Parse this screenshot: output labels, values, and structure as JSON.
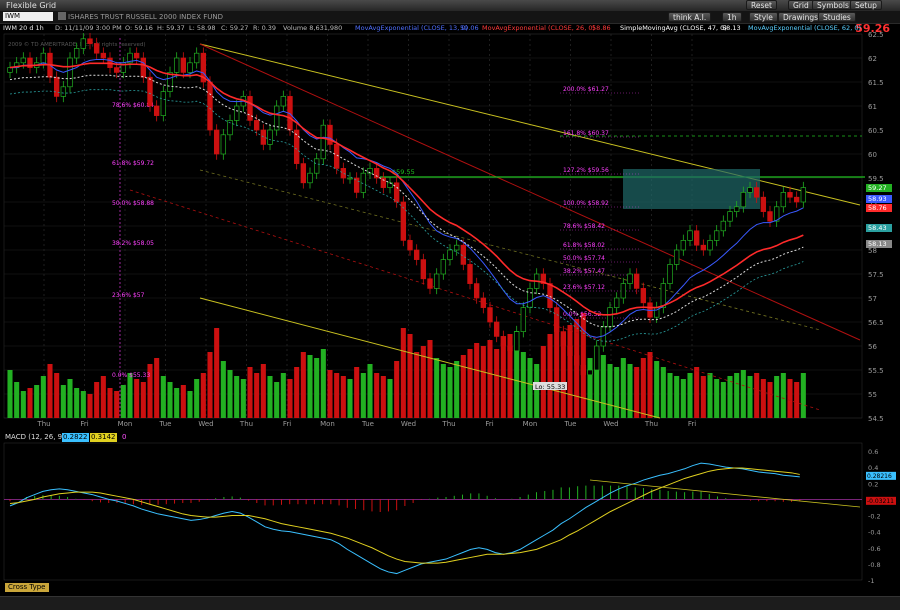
{
  "window": {
    "title": "Flexible Grid"
  },
  "header": {
    "symbol": "IWM",
    "symbol_name": "ISHARES TRUST RUSSELL 2000 INDEX FUND",
    "last_price": "59.26",
    "buttons": [
      "Reset",
      "Grid",
      "Symbols",
      "Setup"
    ],
    "tools": [
      "think A.I.",
      "1h",
      "Style",
      "Drawings",
      "Studies"
    ]
  },
  "info_line": [
    "IWM 20 d 1h",
    "D: 11/11/09 3:00 PM",
    "O: 59.16",
    "H: 59.37",
    "L: 58.98",
    "C: 59.27",
    "R: 0.39",
    "Volume 8,631,980",
    "MovAvgExponential (CLOSE, 13, 0)",
    "MovAvgExponential (CLOSE, 26, 0)",
    "SimpleMovingAvg (CLOSE, 47, 0)",
    "MovAvgExponential (CLOSE, 62, 0)"
  ],
  "info_values": [
    "59.06",
    "58.86",
    "58.13"
  ],
  "watermark": "2009 © TD AMERITRADE, Inc. (all rights reserved)",
  "macd_header": [
    "MACD (12, 26, 9)",
    "0.2822",
    "0.3142",
    "0"
  ],
  "cross_type": "Cross Type",
  "colors": {
    "up": "#22b022",
    "down": "#cc1010",
    "ema13": "#3a5aff",
    "ema26": "#ff2a2a",
    "macd": "#3ac0ff",
    "signal": "#e0d020",
    "fib": "#ff40ff",
    "box": "#1f6a6a"
  },
  "chart_data": [
    {
      "type": "candlestick",
      "title": "IWM 20 d 1h",
      "x_tick_labels": [
        "Thu",
        "Fri",
        "Mon",
        "Tue",
        "Wed",
        "Thu",
        "Fri",
        "Mon",
        "Tue",
        "Wed",
        "Thu",
        "Fri",
        "Mon",
        "Tue",
        "Wed",
        "Thu",
        "Fri"
      ],
      "y_tick_labels": [
        62.5,
        62,
        61.5,
        61,
        60.5,
        60,
        59.5,
        59,
        58.5,
        58,
        57.5,
        57,
        56.5,
        56,
        55.5,
        55,
        54.5
      ],
      "ylim": [
        54.5,
        62.5
      ],
      "right_axis_badges": [
        "59.27",
        "58.93",
        "58.76",
        "58.43",
        "58.13"
      ],
      "fib_retracement": [
        {
          "level": "200.0%",
          "price": "$61.27"
        },
        {
          "level": "161.8%",
          "price": "$60.37"
        },
        {
          "level": "127.2%",
          "price": "$59.56"
        },
        {
          "level": "100.0%",
          "price": "$58.92"
        },
        {
          "level": "78.6%",
          "price": "$58.42"
        },
        {
          "level": "61.8%",
          "price": "$58.02"
        },
        {
          "level": "50.0%",
          "price": "$57.74"
        },
        {
          "level": "38.2%",
          "price": "$57.47"
        },
        {
          "level": "23.6%",
          "price": "$57.12"
        },
        {
          "level": "0.0%",
          "price": "$56.52"
        }
      ],
      "fib_left": [
        {
          "level": "78.6%",
          "price": "$60.84"
        },
        {
          "level": "61.8%",
          "price": "$59.72"
        },
        {
          "level": "50.0%",
          "price": "$58.88"
        },
        {
          "level": "38.2%",
          "price": "$58.05"
        },
        {
          "level": "23.6%",
          "price": "$57"
        },
        {
          "level": "0.0%",
          "price": "$55.33"
        }
      ],
      "horizontal_line_label": "$59.55",
      "low_label": "Lo: 55.33",
      "close": [
        61.8,
        61.9,
        62.0,
        61.8,
        61.9,
        62.1,
        61.6,
        61.2,
        61.4,
        62.0,
        62.2,
        62.4,
        62.3,
        62.1,
        62.0,
        61.8,
        61.7,
        61.9,
        62.1,
        62.0,
        61.6,
        61.0,
        60.8,
        61.3,
        61.7,
        62.0,
        61.7,
        61.9,
        62.1,
        61.5,
        60.5,
        60.0,
        60.4,
        60.7,
        61.0,
        61.2,
        60.7,
        60.5,
        60.2,
        60.5,
        61.0,
        61.2,
        60.5,
        59.8,
        59.4,
        59.6,
        59.9,
        60.6,
        60.2,
        59.7,
        59.5,
        59.5,
        59.2,
        59.6,
        59.7,
        59.5,
        59.3,
        59.4,
        59.0,
        58.2,
        58.0,
        57.8,
        57.4,
        57.2,
        57.5,
        57.8,
        58.0,
        58.1,
        57.7,
        57.3,
        57.0,
        56.8,
        56.5,
        56.2,
        56.0,
        55.9,
        56.3,
        56.8,
        57.2,
        57.5,
        57.3,
        56.8,
        56.3,
        56.0,
        55.8,
        55.6,
        55.4,
        55.5,
        56.0,
        56.4,
        56.8,
        57.0,
        57.3,
        57.5,
        57.2,
        56.9,
        56.6,
        56.8,
        57.3,
        57.7,
        58.0,
        58.2,
        58.4,
        58.1,
        58.0,
        58.2,
        58.4,
        58.6,
        58.8,
        58.9,
        59.2,
        59.3,
        59.1,
        58.8,
        58.6,
        58.9,
        59.2,
        59.1,
        59.0,
        59.3
      ],
      "ema13": [
        61.8,
        61.8,
        61.85,
        61.85,
        61.85,
        61.9,
        61.85,
        61.75,
        61.7,
        61.75,
        61.8,
        61.9,
        61.95,
        61.97,
        61.97,
        61.95,
        61.9,
        61.9,
        61.93,
        61.95,
        61.9,
        61.75,
        61.6,
        61.55,
        61.58,
        61.63,
        61.64,
        61.67,
        61.73,
        61.69,
        61.52,
        61.3,
        61.17,
        61.1,
        61.09,
        61.1,
        61.05,
        60.97,
        60.86,
        60.81,
        60.84,
        60.89,
        60.84,
        60.69,
        60.51,
        60.38,
        60.31,
        60.35,
        60.33,
        60.24,
        60.13,
        60.04,
        59.92,
        59.9,
        59.87,
        59.82,
        59.75,
        59.7,
        59.6,
        59.41,
        59.21,
        59.01,
        58.78,
        58.55,
        58.4,
        58.32,
        58.27,
        58.24,
        58.16,
        58.04,
        57.89,
        57.73,
        57.55,
        57.36,
        57.16,
        56.98,
        56.88,
        56.88,
        56.93,
        57.01,
        57.05,
        56.99,
        56.89,
        56.76,
        56.62,
        56.48,
        56.33,
        56.21,
        56.18,
        56.21,
        56.29,
        56.39,
        56.52,
        56.66,
        56.74,
        56.76,
        56.74,
        56.75,
        56.83,
        56.96,
        57.11,
        57.26,
        57.42,
        57.51,
        57.58,
        57.67,
        57.77,
        57.89,
        58.02,
        58.14,
        58.29,
        58.43,
        58.53,
        58.57,
        58.57,
        58.62,
        58.71,
        58.77,
        58.81,
        58.88
      ],
      "ema26": [
        61.8,
        61.82,
        61.84,
        61.84,
        61.85,
        61.86,
        61.86,
        61.84,
        61.82,
        61.82,
        61.84,
        61.87,
        61.89,
        61.89,
        61.89,
        61.89,
        61.87,
        61.86,
        61.87,
        61.87,
        61.86,
        61.81,
        61.74,
        61.69,
        61.66,
        61.65,
        61.63,
        61.63,
        61.65,
        61.6,
        61.5,
        61.37,
        61.27,
        61.2,
        61.15,
        61.12,
        61.06,
        60.99,
        60.91,
        60.85,
        60.82,
        60.8,
        60.75,
        60.65,
        60.53,
        60.43,
        60.34,
        60.33,
        60.3,
        60.23,
        60.15,
        60.08,
        60.0,
        59.93,
        59.86,
        59.79,
        59.71,
        59.65,
        59.56,
        59.43,
        59.29,
        59.15,
        59.0,
        58.85,
        58.74,
        58.65,
        58.57,
        58.51,
        58.42,
        58.33,
        58.23,
        58.12,
        58.0,
        57.87,
        57.72,
        57.58,
        57.47,
        57.4,
        57.36,
        57.35,
        57.33,
        57.28,
        57.21,
        57.12,
        57.03,
        56.93,
        56.82,
        56.73,
        56.67,
        56.65,
        56.65,
        56.67,
        56.71,
        56.77,
        56.8,
        56.81,
        56.8,
        56.8,
        56.84,
        56.9,
        56.97,
        57.06,
        57.15,
        57.22,
        57.27,
        57.34,
        57.42,
        57.5,
        57.59,
        57.68,
        57.78,
        57.88,
        57.96,
        58.01,
        58.04,
        58.09,
        58.16,
        58.21,
        58.25,
        58.31
      ],
      "volume": [
        32,
        24,
        18,
        20,
        22,
        28,
        36,
        30,
        22,
        26,
        20,
        18,
        16,
        24,
        28,
        20,
        18,
        22,
        30,
        26,
        24,
        36,
        40,
        28,
        24,
        20,
        22,
        18,
        26,
        30,
        44,
        60,
        38,
        32,
        28,
        26,
        34,
        30,
        36,
        28,
        24,
        30,
        26,
        34,
        44,
        42,
        40,
        46,
        32,
        30,
        28,
        26,
        34,
        30,
        36,
        30,
        28,
        26,
        38,
        60,
        56,
        44,
        48,
        52,
        40,
        36,
        34,
        38,
        42,
        46,
        50,
        48,
        52,
        46,
        50,
        56,
        58,
        44,
        40,
        36,
        48,
        56,
        58,
        54,
        62,
        66,
        70,
        40,
        46,
        42,
        36,
        34,
        40,
        36,
        34,
        40,
        44,
        38,
        34,
        30,
        28,
        26,
        30,
        34,
        28,
        30,
        26,
        24,
        28,
        30,
        32,
        28,
        30,
        26,
        24,
        28,
        30,
        26,
        24,
        30
      ],
      "macd": [
        -0.08,
        -0.04,
        0.02,
        0.06,
        0.1,
        0.12,
        0.13,
        0.12,
        0.1,
        0.08,
        0.06,
        0.03,
        0.0,
        -0.02,
        -0.05,
        -0.08,
        -0.12,
        -0.15,
        -0.18,
        -0.2,
        -0.22,
        -0.24,
        -0.26,
        -0.25,
        -0.23,
        -0.2,
        -0.17,
        -0.15,
        -0.17,
        -0.22,
        -0.28,
        -0.34,
        -0.37,
        -0.39,
        -0.4,
        -0.42,
        -0.44,
        -0.46,
        -0.48,
        -0.5,
        -0.55,
        -0.62,
        -0.68,
        -0.74,
        -0.8,
        -0.86,
        -0.9,
        -0.92,
        -0.88,
        -0.84,
        -0.8,
        -0.78,
        -0.76,
        -0.74,
        -0.7,
        -0.66,
        -0.62,
        -0.6,
        -0.62,
        -0.66,
        -0.68,
        -0.66,
        -0.62,
        -0.56,
        -0.5,
        -0.44,
        -0.38,
        -0.3,
        -0.24,
        -0.17,
        -0.1,
        -0.04,
        0.02,
        0.08,
        0.13,
        0.17,
        0.2,
        0.24,
        0.27,
        0.3,
        0.32,
        0.35,
        0.38,
        0.42,
        0.45,
        0.44,
        0.42,
        0.4,
        0.39,
        0.38,
        0.36,
        0.34,
        0.33,
        0.32,
        0.3,
        0.29,
        0.28
      ],
      "signal": [
        -0.05,
        -0.04,
        -0.02,
        0.0,
        0.03,
        0.05,
        0.07,
        0.08,
        0.09,
        0.09,
        0.09,
        0.08,
        0.06,
        0.04,
        0.02,
        0.0,
        -0.03,
        -0.06,
        -0.09,
        -0.12,
        -0.15,
        -0.18,
        -0.2,
        -0.21,
        -0.22,
        -0.22,
        -0.21,
        -0.2,
        -0.2,
        -0.2,
        -0.22,
        -0.24,
        -0.27,
        -0.3,
        -0.32,
        -0.34,
        -0.36,
        -0.38,
        -0.4,
        -0.42,
        -0.45,
        -0.48,
        -0.52,
        -0.56,
        -0.6,
        -0.65,
        -0.7,
        -0.74,
        -0.77,
        -0.78,
        -0.79,
        -0.79,
        -0.79,
        -0.78,
        -0.76,
        -0.74,
        -0.72,
        -0.7,
        -0.68,
        -0.68,
        -0.68,
        -0.67,
        -0.66,
        -0.64,
        -0.62,
        -0.58,
        -0.54,
        -0.5,
        -0.44,
        -0.39,
        -0.33,
        -0.27,
        -0.21,
        -0.15,
        -0.1,
        -0.05,
        0.0,
        0.05,
        0.1,
        0.14,
        0.18,
        0.22,
        0.26,
        0.29,
        0.32,
        0.35,
        0.37,
        0.38,
        0.39,
        0.39,
        0.38,
        0.37,
        0.36,
        0.35,
        0.34,
        0.33,
        0.31
      ],
      "macd_axis": [
        "0.6",
        "0.4",
        "0.2",
        "0",
        "-0.2",
        "-0.4",
        "-0.6",
        "-0.8",
        "-1"
      ],
      "macd_badges": [
        "0.28216",
        "-0.03211"
      ]
    }
  ]
}
